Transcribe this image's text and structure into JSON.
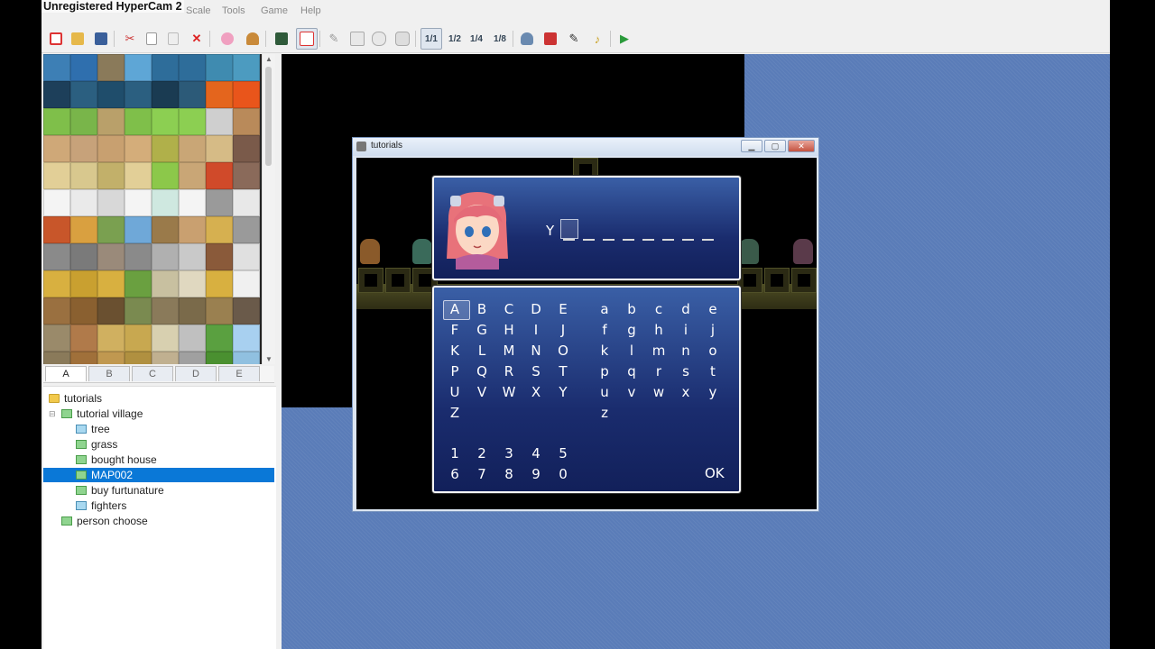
{
  "window": {
    "title": "Unregistered HyperCam 2"
  },
  "menu": [
    "Scale",
    "Tools",
    "Game",
    "Help"
  ],
  "tileset_tabs": [
    {
      "label": "A",
      "active": true
    },
    {
      "label": "B",
      "active": false
    },
    {
      "label": "C",
      "active": false
    },
    {
      "label": "D",
      "active": false
    },
    {
      "label": "E",
      "active": false
    }
  ],
  "map_tree": {
    "root": "tutorials",
    "nodes": [
      {
        "label": "tutorial village",
        "level": 1
      },
      {
        "label": "tree",
        "level": 2
      },
      {
        "label": "grass",
        "level": 2
      },
      {
        "label": "bought house",
        "level": 2
      },
      {
        "label": "MAP002",
        "level": 2,
        "selected": true
      },
      {
        "label": "buy furtunature",
        "level": 2
      },
      {
        "label": "fighters",
        "level": 2
      },
      {
        "label": "person choose",
        "level": 1
      }
    ]
  },
  "game_window": {
    "title": "tutorials",
    "name_input": {
      "entered": "Y",
      "slots": 8
    },
    "letters_upper": [
      [
        "A",
        "B",
        "C",
        "D",
        "E"
      ],
      [
        "F",
        "G",
        "H",
        "I",
        "J"
      ],
      [
        "K",
        "L",
        "M",
        "N",
        "O"
      ],
      [
        "P",
        "Q",
        "R",
        "S",
        "T"
      ],
      [
        "U",
        "V",
        "W",
        "X",
        "Y"
      ],
      [
        "Z"
      ]
    ],
    "letters_lower": [
      [
        "a",
        "b",
        "c",
        "d",
        "e"
      ],
      [
        "f",
        "g",
        "h",
        "i",
        "j"
      ],
      [
        "k",
        "l",
        "m",
        "n",
        "o"
      ],
      [
        "p",
        "q",
        "r",
        "s",
        "t"
      ],
      [
        "u",
        "v",
        "w",
        "x",
        "y"
      ],
      [
        "z"
      ]
    ],
    "digits": [
      [
        "1",
        "2",
        "3",
        "4",
        "5"
      ],
      [
        "6",
        "7",
        "8",
        "9",
        "0"
      ]
    ],
    "ok_label": "OK",
    "selected_char": "A"
  },
  "toolbar_icons": [
    "new-project-icon",
    "open-project-icon",
    "save-icon",
    "cut-icon",
    "copy-icon",
    "paste-icon",
    "delete-icon",
    "undo-icon",
    "layer-map-icon",
    "layer-event-icon",
    "pencil-icon",
    "rectangle-icon",
    "ellipse-icon",
    "fill-icon",
    "zoom-1-1-icon",
    "zoom-1-2-icon",
    "zoom-1-4-icon",
    "zoom-1-8-icon",
    "database-icon",
    "resource-manager-icon",
    "script-editor-icon",
    "sound-test-icon",
    "playtest-icon"
  ],
  "colors": {
    "selection": "#0a78d7",
    "map_bg": "#5a7cb8",
    "window_blue": "#1a2c6e"
  }
}
